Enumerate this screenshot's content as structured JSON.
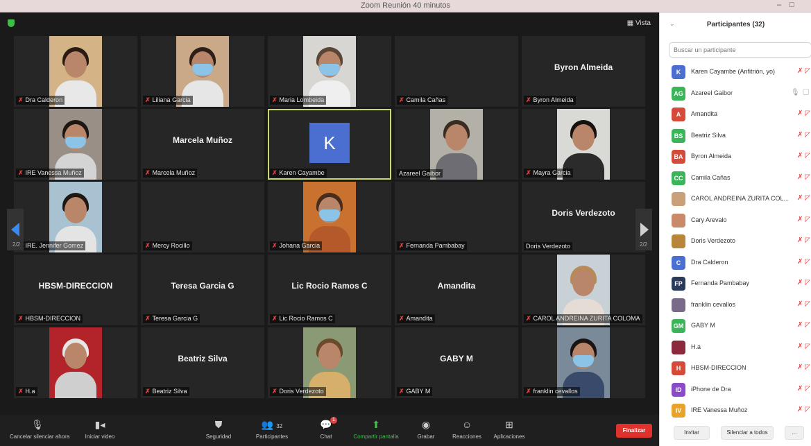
{
  "window": {
    "title": "Zoom Reunión 40 minutos"
  },
  "meeting": {
    "view_label": "Vista",
    "page_left": "2/2",
    "page_right": "2/2"
  },
  "tiles": [
    {
      "label": "Dra Calderon",
      "big": "",
      "kind": "photo",
      "muted": true,
      "photo": {
        "bg": "#d4b487",
        "hair": "#2a1b12",
        "mask": false,
        "body": "#e8e8e8"
      }
    },
    {
      "label": "Liliana Garcia",
      "big": "",
      "kind": "photo",
      "muted": true,
      "photo": {
        "bg": "#c9a987",
        "hair": "#2d1f16",
        "mask": true,
        "body": "#e6e6e6"
      }
    },
    {
      "label": "Maria Lombeida",
      "big": "",
      "kind": "photo",
      "muted": true,
      "photo": {
        "bg": "#d8d6d2",
        "hair": "#5b4536",
        "mask": true,
        "body": "#efefef"
      }
    },
    {
      "label": "Camila Cañas",
      "big": "",
      "kind": "empty",
      "muted": true
    },
    {
      "label": "Byron Almeida",
      "big": "Byron Almeida",
      "kind": "name",
      "muted": true
    },
    {
      "label": "IRE Vanessa Muñoz",
      "big": "",
      "kind": "photo",
      "muted": true,
      "photo": {
        "bg": "#9a8f86",
        "hair": "#1d1613",
        "mask": true,
        "body": "#d4d4d4"
      }
    },
    {
      "label": "Marcela Muñoz",
      "big": "Marcela Muñoz",
      "kind": "name",
      "muted": true
    },
    {
      "label": "Karen Cayambe",
      "big": "",
      "kind": "avatar",
      "muted": true,
      "avatar": "K"
    },
    {
      "label": "Azareel Gaibor",
      "big": "",
      "kind": "photo",
      "muted": false,
      "photo": {
        "bg": "#b3b0a8",
        "hair": "#3a2c22",
        "mask": false,
        "body": "#6d6d73"
      }
    },
    {
      "label": "Mayra Garcia",
      "big": "",
      "kind": "photo",
      "muted": true,
      "photo": {
        "bg": "#d9dad6",
        "hair": "#17120f",
        "mask": false,
        "body": "#2b2b2b"
      }
    },
    {
      "label": "IRE. Jennifer Gomez",
      "big": "",
      "kind": "photo",
      "muted": true,
      "photo": {
        "bg": "#a8c2d2",
        "hair": "#1f1712",
        "mask": false,
        "body": "#e4e4e4"
      }
    },
    {
      "label": "Mercy Rocillo",
      "big": "",
      "kind": "empty",
      "muted": true
    },
    {
      "label": "Johana Garcia",
      "big": "",
      "kind": "photo",
      "muted": true,
      "photo": {
        "bg": "#c9712f",
        "hair": "#4a2c1c",
        "mask": true,
        "body": "#b45a2a"
      }
    },
    {
      "label": "Fernanda Pambabay",
      "big": "",
      "kind": "empty",
      "muted": true
    },
    {
      "label": "Doris Verdezoto",
      "big": "Doris Verdezoto",
      "kind": "name",
      "muted": false
    },
    {
      "label": "HBSM-DIRECCION",
      "big": "HBSM-DIRECCION",
      "kind": "name",
      "muted": true
    },
    {
      "label": "Teresa Garcia G",
      "big": "Teresa Garcia G",
      "kind": "name",
      "muted": true
    },
    {
      "label": "Lic Rocio Ramos C",
      "big": "Lic Rocio Ramos C",
      "kind": "name",
      "muted": true
    },
    {
      "label": "Amandita",
      "big": "Amandita",
      "kind": "name",
      "muted": true
    },
    {
      "label": "CAROL ANDREINA ZURITA COLOMA",
      "big": "",
      "kind": "photo",
      "muted": true,
      "photo": {
        "bg": "#c8d1d6",
        "hair": "#b88a5a",
        "mask": false,
        "body": "#e6dcd6"
      }
    },
    {
      "label": "H.a",
      "big": "",
      "kind": "photo",
      "muted": true,
      "photo": {
        "bg": "#b3242a",
        "hair": "#e6e6e6",
        "mask": false,
        "body": "#cfcfcf"
      }
    },
    {
      "label": "Beatriz Silva",
      "big": "Beatriz Silva",
      "kind": "name",
      "muted": true
    },
    {
      "label": "Doris Verdezoto",
      "big": "",
      "kind": "photo",
      "muted": true,
      "photo": {
        "bg": "#8a9a74",
        "hair": "#6a4a2a",
        "mask": false,
        "body": "#d6b06a"
      }
    },
    {
      "label": "GABY M",
      "big": "GABY M",
      "kind": "name",
      "muted": true
    },
    {
      "label": "franklin cevallos",
      "big": "",
      "kind": "photo",
      "muted": true,
      "photo": {
        "bg": "#7a8a98",
        "hair": "#1a1512",
        "mask": true,
        "body": "#3a4a6a"
      }
    }
  ],
  "toolbar": {
    "mute_label": "Cancelar silenciar ahora",
    "video_label": "Iniciar video",
    "security_label": "Seguridad",
    "participants_label": "Participantes",
    "participants_count": "32",
    "chat_label": "Chat",
    "chat_badge": "1",
    "share_label": "Compartir pantalla",
    "record_label": "Grabar",
    "reactions_label": "Reacciones",
    "apps_label": "Aplicaciones",
    "end_label": "Finalizar",
    "accent_share": "#40c04d",
    "end_color": "#e1312d"
  },
  "panel": {
    "title": "Participantes (32)",
    "search_placeholder": "Buscar un participante",
    "participants": [
      {
        "initials": "K",
        "name": "Karen Cayambe (Anfitrión, yo)",
        "color": "#4a6fd1",
        "status": "muted"
      },
      {
        "initials": "AG",
        "name": "Azareel Gaibor",
        "color": "#3cb55a",
        "status": "mic"
      },
      {
        "initials": "A",
        "name": "Amandita",
        "color": "#d64a3a",
        "status": "muted"
      },
      {
        "initials": "BS",
        "name": "Beatriz Silva",
        "color": "#3cb55a",
        "status": "muted"
      },
      {
        "initials": "BA",
        "name": "Byron Almeida",
        "color": "#d64a3a",
        "status": "muted"
      },
      {
        "initials": "CC",
        "name": "Camila Cañas",
        "color": "#3cb55a",
        "status": "muted"
      },
      {
        "initials": "",
        "name": "CAROL ANDREINA ZURITA COL...",
        "color": "#c9a07a",
        "status": "muted"
      },
      {
        "initials": "",
        "name": "Cary Arevalo",
        "color": "#c98a6a",
        "status": "muted"
      },
      {
        "initials": "",
        "name": "Doris Verdezoto",
        "color": "#b8863a",
        "status": "muted"
      },
      {
        "initials": "C",
        "name": "Dra Calderon",
        "color": "#4a6fd1",
        "status": "muted"
      },
      {
        "initials": "FP",
        "name": "Fernanda Pambabay",
        "color": "#2a3a5a",
        "status": "muted"
      },
      {
        "initials": "",
        "name": "franklin cevallos",
        "color": "#7a6a8a",
        "status": "muted"
      },
      {
        "initials": "GM",
        "name": "GABY M",
        "color": "#3cb55a",
        "status": "muted"
      },
      {
        "initials": "",
        "name": "H.a",
        "color": "#8a2a3a",
        "status": "muted"
      },
      {
        "initials": "H",
        "name": "HBSM-DIRECCION",
        "color": "#d64a3a",
        "status": "muted"
      },
      {
        "initials": "ID",
        "name": "iPhone de Dra",
        "color": "#8a4ac9",
        "status": "muted"
      },
      {
        "initials": "IV",
        "name": "IRE Vanessa Muñoz",
        "color": "#e8a32a",
        "status": "muted"
      }
    ],
    "invite_label": "Invitar",
    "mute_all_label": "Silenciar a todos",
    "more_label": "..."
  }
}
